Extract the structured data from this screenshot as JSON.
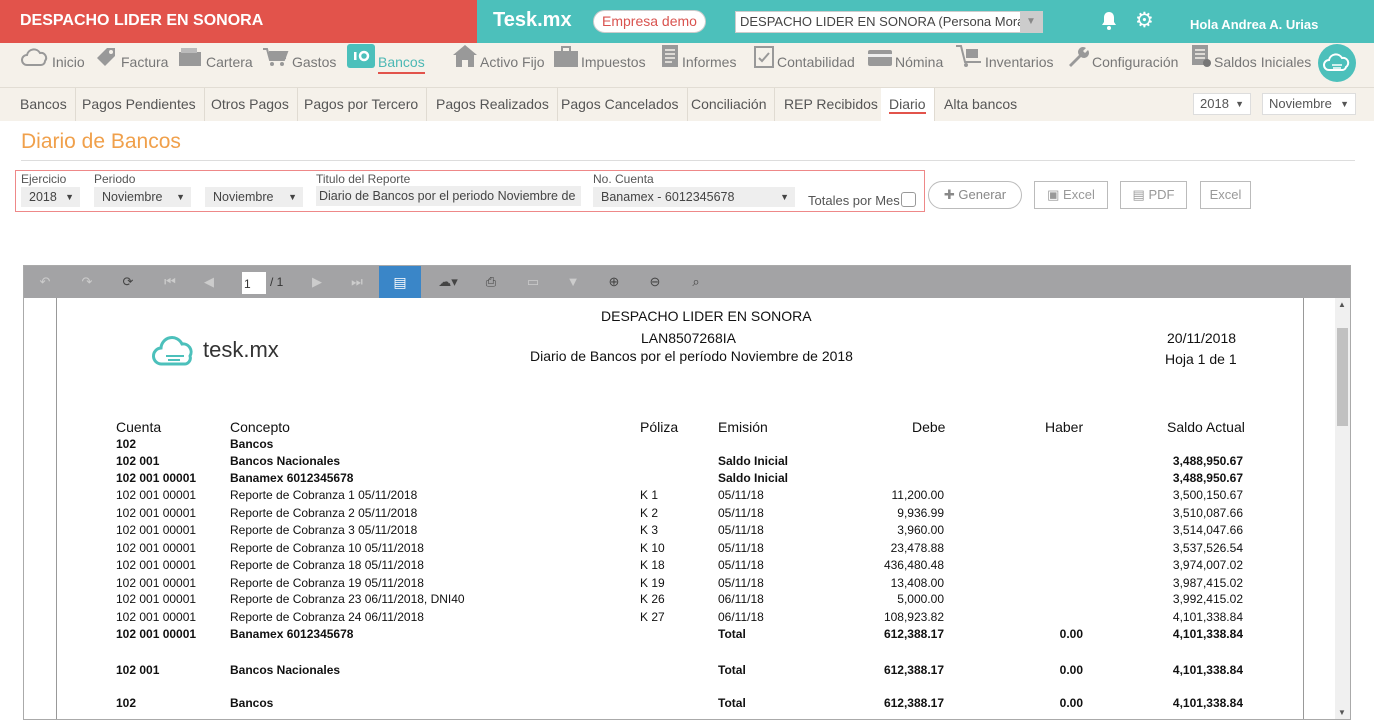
{
  "topbar": {
    "company_name": "DESPACHO LIDER EN SONORA",
    "brand": "Tesk.mx",
    "empresa_badge": "Empresa demo",
    "company_select": "DESPACHO LIDER EN SONORA (Persona Moral)",
    "greeting": "Hola Andrea A. Urias"
  },
  "mainnav": [
    {
      "label": "Inicio",
      "icon": "cloud-icon"
    },
    {
      "label": "Factura",
      "icon": "tag-icon"
    },
    {
      "label": "Cartera",
      "icon": "wallet-icon"
    },
    {
      "label": "Gastos",
      "icon": "cart-icon"
    },
    {
      "label": "Bancos",
      "icon": "bank-icon"
    },
    {
      "label": "Activo Fijo",
      "icon": "house-icon"
    },
    {
      "label": "Impuestos",
      "icon": "briefcase-icon"
    },
    {
      "label": "Informes",
      "icon": "document-icon"
    },
    {
      "label": "Contabilidad",
      "icon": "clipboard-icon"
    },
    {
      "label": "Nómina",
      "icon": "card-icon"
    },
    {
      "label": "Inventarios",
      "icon": "dolly-icon"
    },
    {
      "label": "Configuración",
      "icon": "wrench-icon"
    },
    {
      "label": "Saldos Iniciales",
      "icon": "list-icon"
    }
  ],
  "subnav": [
    "Bancos",
    "Pagos Pendientes",
    "Otros Pagos",
    "Pagos por Tercero",
    "Pagos Realizados",
    "Pagos Cancelados",
    "Conciliación",
    "REP Recibidos",
    "Diario",
    "Alta bancos"
  ],
  "subnav_year": "2018",
  "subnav_month": "Noviembre",
  "page_title": "Diario de Bancos",
  "filters": {
    "ejercicio_label": "Ejercicio",
    "ejercicio_value": "2018",
    "periodo_label": "Periodo",
    "periodo_from": "Noviembre",
    "periodo_to": "Noviembre",
    "titulo_label": "Titulo del Reporte",
    "titulo_value": "Diario de Bancos por el periodo Noviembre de",
    "cuenta_label": "No. Cuenta",
    "cuenta_value": "Banamex - 6012345678",
    "totales_label": "Totales por Mes"
  },
  "buttons": {
    "generar": "Generar",
    "excel1": "Excel",
    "pdf": "PDF",
    "excel2": "Excel"
  },
  "viewer": {
    "page_current": "1",
    "page_total": "/ 1"
  },
  "report": {
    "company": "DESPACHO LIDER EN SONORA",
    "rfc": "LAN8507268IA",
    "subtitle": "Diario de Bancos por el período Noviembre de 2018",
    "date": "20/11/2018",
    "page": "Hoja 1 de 1",
    "logo_text": "tesk.mx",
    "headers": {
      "cuenta": "Cuenta",
      "concepto": "Concepto",
      "poliza": "Póliza",
      "emision": "Emisión",
      "debe": "Debe",
      "haber": "Haber",
      "saldo": "Saldo Actual"
    },
    "rows": [
      {
        "b": true,
        "cuenta": "102",
        "concepto": "Bancos",
        "poliza": "",
        "emision": "",
        "debe": "",
        "haber": "",
        "saldo": ""
      },
      {
        "b": true,
        "cuenta": "102 001",
        "concepto": "Bancos Nacionales",
        "poliza": "",
        "emision": "Saldo Inicial",
        "debe": "",
        "haber": "",
        "saldo": "3,488,950.67"
      },
      {
        "b": true,
        "cuenta": "102 001 00001",
        "concepto": "Banamex 6012345678",
        "poliza": "",
        "emision": "Saldo Inicial",
        "debe": "",
        "haber": "",
        "saldo": "3,488,950.67"
      },
      {
        "b": false,
        "cuenta": "102 001 00001",
        "concepto": "Reporte de Cobranza 1 05/11/2018",
        "poliza": "K 1",
        "emision": "05/11/18",
        "debe": "11,200.00",
        "haber": "",
        "saldo": "3,500,150.67"
      },
      {
        "b": false,
        "cuenta": "102 001 00001",
        "concepto": "Reporte de Cobranza 2 05/11/2018",
        "poliza": "K 2",
        "emision": "05/11/18",
        "debe": "9,936.99",
        "haber": "",
        "saldo": "3,510,087.66"
      },
      {
        "b": false,
        "cuenta": "102 001 00001",
        "concepto": "Reporte de Cobranza 3 05/11/2018",
        "poliza": "K 3",
        "emision": "05/11/18",
        "debe": "3,960.00",
        "haber": "",
        "saldo": "3,514,047.66"
      },
      {
        "b": false,
        "cuenta": "102 001 00001",
        "concepto": "Reporte de Cobranza 10 05/11/2018",
        "poliza": "K 10",
        "emision": "05/11/18",
        "debe": "23,478.88",
        "haber": "",
        "saldo": "3,537,526.54"
      },
      {
        "b": false,
        "cuenta": "102 001 00001",
        "concepto": "Reporte de Cobranza 18 05/11/2018",
        "poliza": "K 18",
        "emision": "05/11/18",
        "debe": "436,480.48",
        "haber": "",
        "saldo": "3,974,007.02"
      },
      {
        "b": false,
        "cuenta": "102 001 00001",
        "concepto": "Reporte de Cobranza 19 05/11/2018",
        "poliza": "K 19",
        "emision": "05/11/18",
        "debe": "13,408.00",
        "haber": "",
        "saldo": "3,987,415.02"
      },
      {
        "b": false,
        "cuenta": "102 001 00001",
        "concepto": "Reporte de Cobranza 23 06/11/2018,  DNI40",
        "poliza": "K 26",
        "emision": "06/11/18",
        "debe": "5,000.00",
        "haber": "",
        "saldo": "3,992,415.02"
      },
      {
        "b": false,
        "cuenta": "102 001 00001",
        "concepto": "Reporte de Cobranza 24 06/11/2018",
        "poliza": "K 27",
        "emision": "06/11/18",
        "debe": "108,923.82",
        "haber": "",
        "saldo": "4,101,338.84"
      },
      {
        "b": true,
        "cuenta": "102 001 00001",
        "concepto": "Banamex 6012345678",
        "poliza": "",
        "emision": "Total",
        "debe": "612,388.17",
        "haber": "0.00",
        "saldo": "4,101,338.84"
      },
      {
        "b": true,
        "cuenta": "102 001",
        "concepto": "Bancos Nacionales",
        "poliza": "",
        "emision": "Total",
        "debe": "612,388.17",
        "haber": "0.00",
        "saldo": "4,101,338.84"
      },
      {
        "b": true,
        "cuenta": "102",
        "concepto": "Bancos",
        "poliza": "",
        "emision": "Total",
        "debe": "612,388.17",
        "haber": "0.00",
        "saldo": "4,101,338.84"
      }
    ]
  }
}
